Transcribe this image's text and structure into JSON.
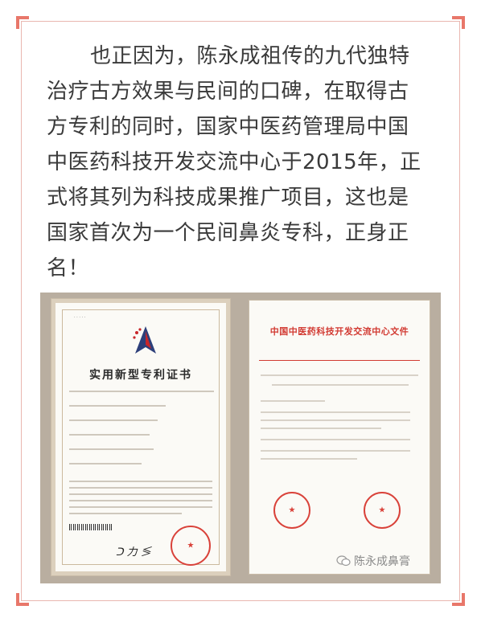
{
  "article": {
    "lines": [
      "也正因为，陈永成祖传的九代独特",
      "治疗古方效果与民间的口碑，在取得古",
      "方专利的同时，国家中医药管理局中国",
      "中医药科技开发交流中心于2015年，正",
      "式将其列为科技成果推广项目，这也是",
      "国家首次为一个民间鼻炎专科，正身正",
      "名！"
    ]
  },
  "patent_certificate": {
    "title": "实用新型专利证书"
  },
  "notice_document": {
    "title": "中国中医药科技开发交流中心文件"
  },
  "watermark": {
    "text": "陈永成鼻膏"
  },
  "colors": {
    "frame_accent": "#e8776a",
    "frame_border": "#e9b7b0",
    "seal_red": "#d9423a",
    "body_text": "#3a3a3a"
  }
}
